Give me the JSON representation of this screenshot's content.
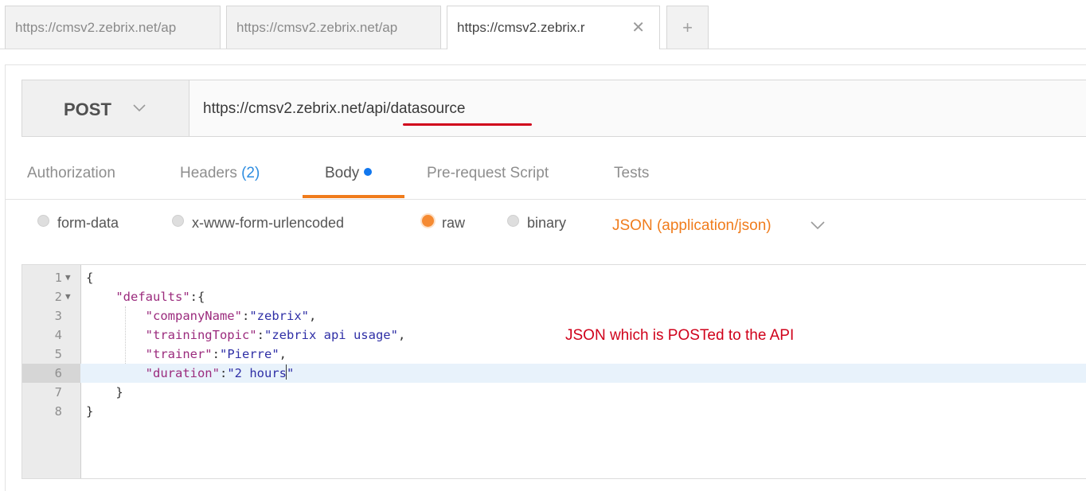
{
  "tabs": [
    {
      "label": "https://cmsv2.zebrix.net/ap"
    },
    {
      "label": "https://cmsv2.zebrix.net/ap"
    },
    {
      "label": "https://cmsv2.zebrix.r",
      "close": "✕"
    },
    {
      "label": "+"
    }
  ],
  "request": {
    "method": "POST",
    "url": "https://cmsv2.zebrix.net/api/datasource"
  },
  "request_tabs": {
    "authorization": "Authorization",
    "headers": "Headers",
    "headers_count": "(2)",
    "body": "Body",
    "prerequest": "Pre-request Script",
    "tests": "Tests"
  },
  "body_options": {
    "form_data": "form-data",
    "urlencoded": "x-www-form-urlencoded",
    "raw": "raw",
    "binary": "binary",
    "content_type": "JSON (application/json)",
    "selected": "raw"
  },
  "editor": {
    "line_numbers": [
      "1",
      "2",
      "3",
      "4",
      "5",
      "6",
      "7",
      "8"
    ],
    "lines": [
      {
        "parts": [
          [
            "p",
            "{"
          ]
        ]
      },
      {
        "parts": [
          [
            "p",
            "    "
          ],
          [
            "k",
            "\"defaults\""
          ],
          [
            "p",
            ":{"
          ]
        ]
      },
      {
        "parts": [
          [
            "p",
            "        "
          ],
          [
            "k",
            "\"companyName\""
          ],
          [
            "p",
            ":"
          ],
          [
            "s",
            "\"zebrix\""
          ],
          [
            "p",
            ","
          ]
        ]
      },
      {
        "parts": [
          [
            "p",
            "        "
          ],
          [
            "k",
            "\"trainingTopic\""
          ],
          [
            "p",
            ":"
          ],
          [
            "s",
            "\"zebrix api usage\""
          ],
          [
            "p",
            ","
          ]
        ]
      },
      {
        "parts": [
          [
            "p",
            "        "
          ],
          [
            "k",
            "\"trainer\""
          ],
          [
            "p",
            ":"
          ],
          [
            "s",
            "\"Pierre\""
          ],
          [
            "p",
            ","
          ]
        ]
      },
      {
        "parts": [
          [
            "p",
            "        "
          ],
          [
            "k",
            "\"duration\""
          ],
          [
            "p",
            ":"
          ],
          [
            "s",
            "\"2 hours\""
          ]
        ]
      },
      {
        "parts": [
          [
            "p",
            "    }"
          ]
        ]
      },
      {
        "parts": [
          [
            "p",
            "}"
          ]
        ]
      }
    ],
    "highlighted_line": "6",
    "annotation": "JSON which is POSTed to the API"
  },
  "colors": {
    "accent": "#f07c1c",
    "annotation_red": "#d0021b",
    "count_blue": "#2e8de0"
  }
}
